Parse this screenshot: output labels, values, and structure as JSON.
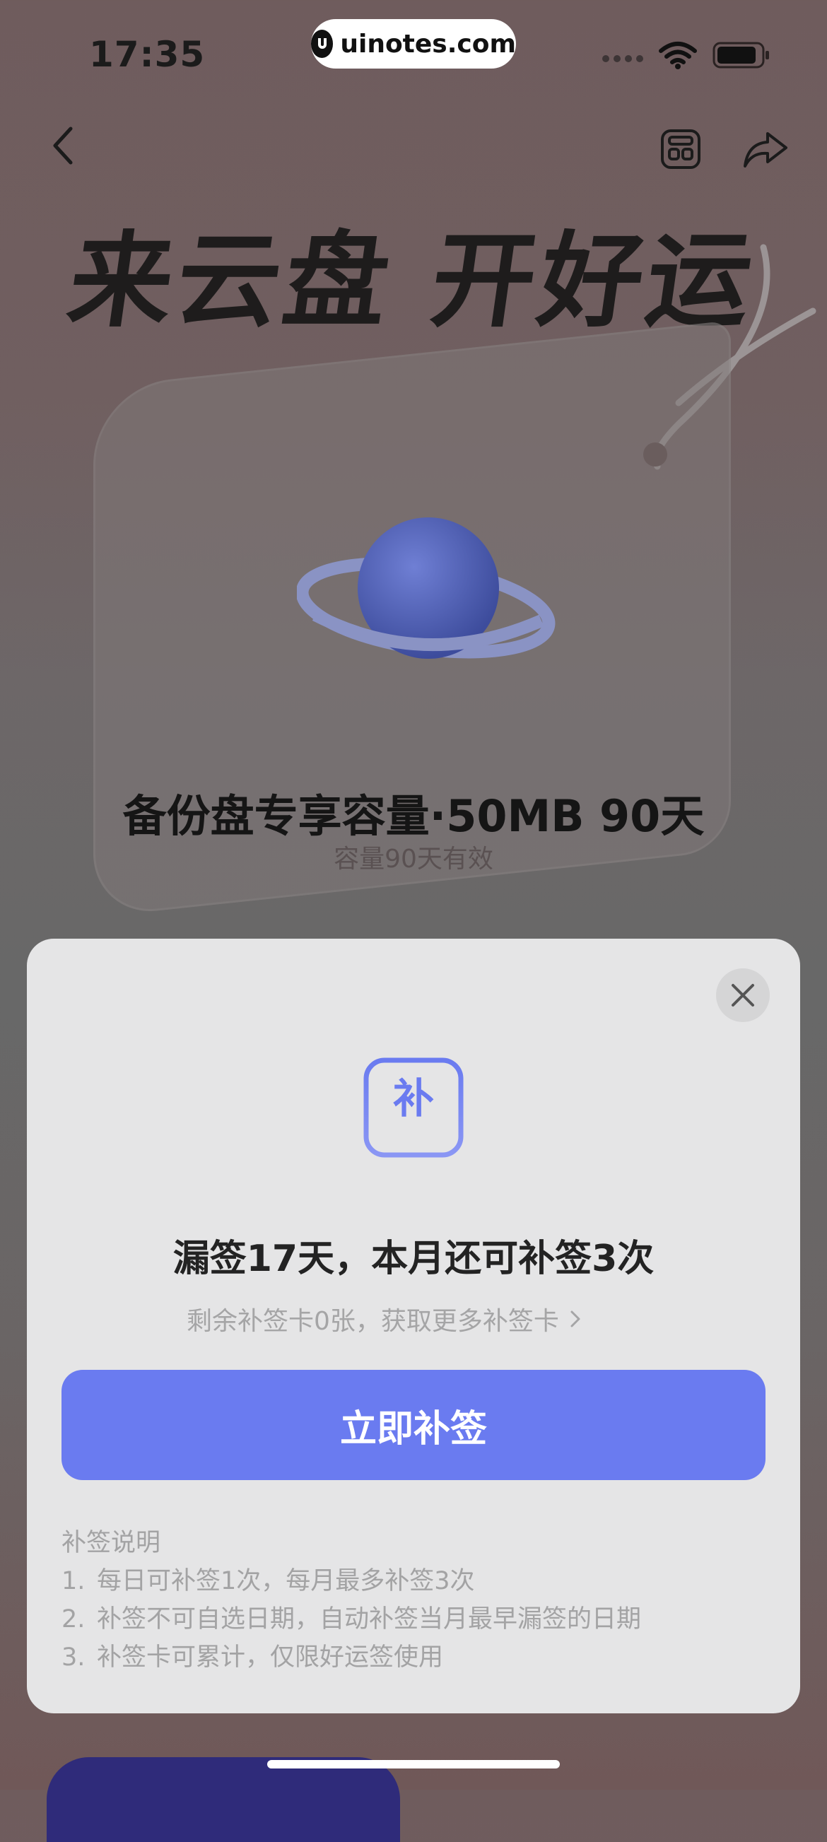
{
  "status": {
    "time": "17:35",
    "watermark": "uinotes.com"
  },
  "hero": {
    "title": "来云盘 开好运"
  },
  "card": {
    "title": "备份盘专享容量·50MB 90天",
    "subtitle": "容量90天有效"
  },
  "sheet": {
    "icon_char": "补",
    "title": "漏签17天，本月还可补签3次",
    "subtitle": "剩余补签卡0张，获取更多补签卡",
    "cta_label": "立即补签",
    "rules_title": "补签说明",
    "rules": [
      {
        "num": "1.",
        "text": "每日可补签1次，每月最多补签3次"
      },
      {
        "num": "2.",
        "text": "补签不可自选日期，自动补签当月最早漏签的日期"
      },
      {
        "num": "3.",
        "text": "补签卡可累计，仅限好运签使用"
      }
    ]
  },
  "colors": {
    "accent": "#6a7bf0",
    "sheet_bg": "#e5e5e6"
  },
  "icons": [
    "back-icon",
    "calendar-icon",
    "share-icon",
    "close-icon",
    "chevron-right-icon",
    "wifi-icon",
    "battery-icon"
  ]
}
